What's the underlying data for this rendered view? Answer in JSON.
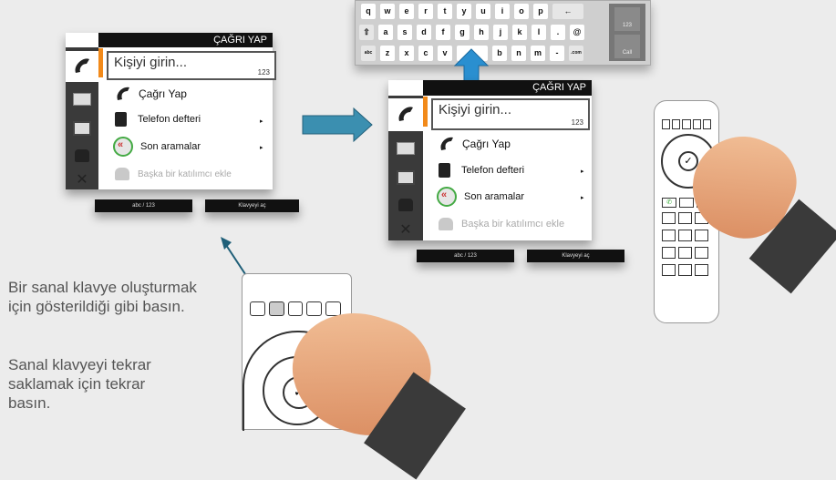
{
  "instructions": {
    "line1": "Bir sanal klavye oluşturmak için gösterildiği gibi basın.",
    "line2": "Sanal klavyeyi tekrar saklamak için tekrar basın."
  },
  "menu": {
    "title": "ÇAĞRI YAP",
    "input_value": "Kişiyi girin...",
    "input_hint": "123",
    "items": [
      {
        "label": "Çağrı Yap",
        "icon": "handset-icon"
      },
      {
        "label": "Telefon defteri",
        "icon": "phonebook-icon",
        "submenu": "▸"
      },
      {
        "label": "Son aramalar",
        "icon": "recent-calls-icon",
        "submenu": "▸"
      },
      {
        "label": "Başka bir katılımcı ekle",
        "icon": "add-participant-icon"
      }
    ],
    "softkeys": [
      "abc / 123",
      "Klavyeyi aç"
    ]
  },
  "keyboard": {
    "row1": [
      "q",
      "w",
      "e",
      "r",
      "t",
      "y",
      "u",
      "i",
      "o",
      "p",
      "←"
    ],
    "row2": [
      "⇧",
      "a",
      "s",
      "d",
      "f",
      "g",
      "h",
      "j",
      "k",
      "l",
      ".",
      "@"
    ],
    "row3": [
      "abc",
      "z",
      "x",
      "c",
      "v",
      "␣",
      "b",
      "n",
      "m",
      "-",
      ".com"
    ],
    "side": [
      "123",
      "Call"
    ]
  },
  "colors": {
    "accent": "#f28a1a",
    "arrow_blue": "#2a8fd0",
    "pointer": "#1f5f78"
  }
}
